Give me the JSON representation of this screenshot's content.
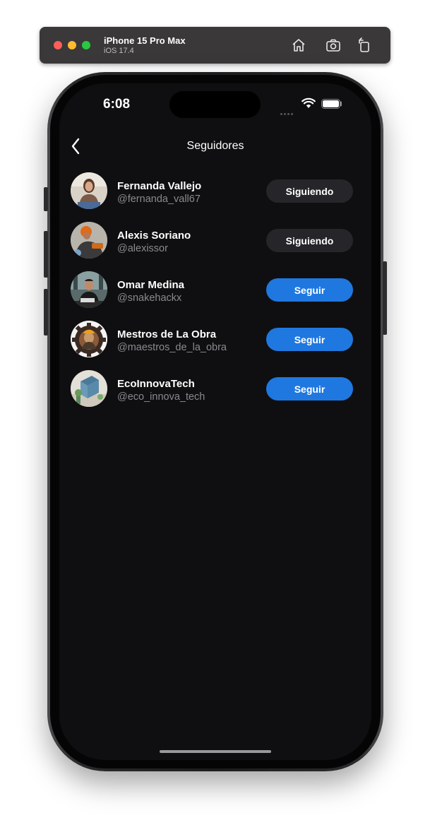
{
  "simulator": {
    "device_name": "iPhone 15 Pro Max",
    "os_version": "iOS 17.4",
    "icons": [
      "home-icon",
      "screenshot-icon",
      "rotate-icon"
    ]
  },
  "status_bar": {
    "time": "6:08"
  },
  "nav": {
    "title": "Seguidores",
    "back_icon": "chevron-left-icon"
  },
  "followers": [
    {
      "name": "Fernanda Vallejo",
      "handle": "@fernanda_vall67",
      "button": "Siguiendo",
      "following": true
    },
    {
      "name": "Alexis Soriano",
      "handle": "@alexissor",
      "button": "Siguiendo",
      "following": true
    },
    {
      "name": "Omar Medina",
      "handle": "@snakehackx",
      "button": "Seguir",
      "following": false
    },
    {
      "name": "Mestros de La Obra",
      "handle": "@maestros_de_la_obra",
      "button": "Seguir",
      "following": false
    },
    {
      "name": "EcoInnovaTech",
      "handle": "@eco_innova_tech",
      "button": "Seguir",
      "following": false
    }
  ],
  "colors": {
    "background": "#0f0f11",
    "follow_button": "#1f78e0",
    "following_button": "#26262a",
    "handle_text": "#8a8a8f"
  }
}
